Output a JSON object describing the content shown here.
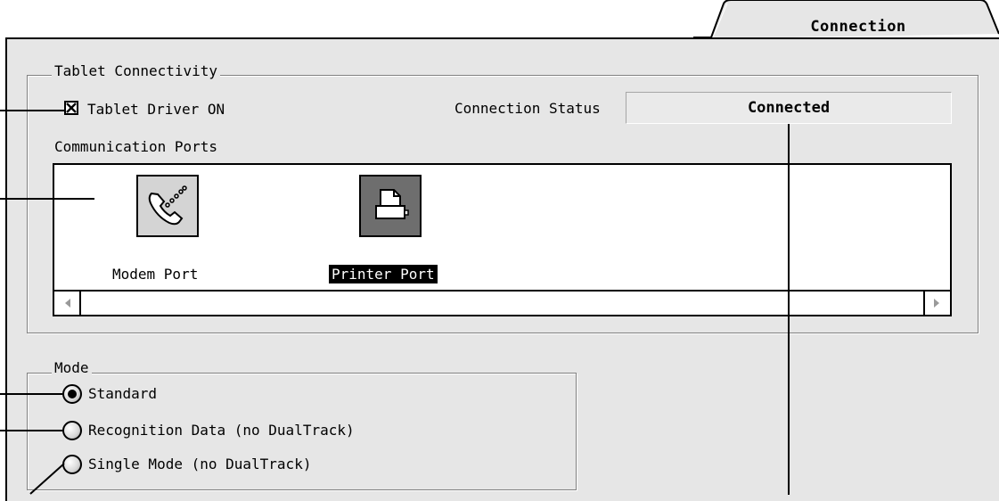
{
  "tab": {
    "label": "Connection"
  },
  "tablet_connectivity": {
    "title": "Tablet Connectivity",
    "driver_checkbox": {
      "label": "Tablet Driver ON",
      "checked": true
    },
    "status_label": "Connection Status",
    "status_value": "Connected",
    "ports_label": "Communication Ports",
    "ports": [
      {
        "label": "Modem Port",
        "icon": "modem-phone-icon",
        "selected": false
      },
      {
        "label": "Printer Port",
        "icon": "printer-icon",
        "selected": true
      }
    ]
  },
  "mode": {
    "title": "Mode",
    "options": [
      {
        "label": "Standard",
        "selected": true
      },
      {
        "label": "Recognition Data (no DualTrack)",
        "selected": false
      },
      {
        "label": "Single Mode (no DualTrack)",
        "selected": false
      }
    ]
  },
  "colors": {
    "panel": "#e6e6e6",
    "selection": "#000000",
    "printer_icon_bg": "#6e6e6e",
    "modem_icon_bg": "#d4d4d4"
  }
}
